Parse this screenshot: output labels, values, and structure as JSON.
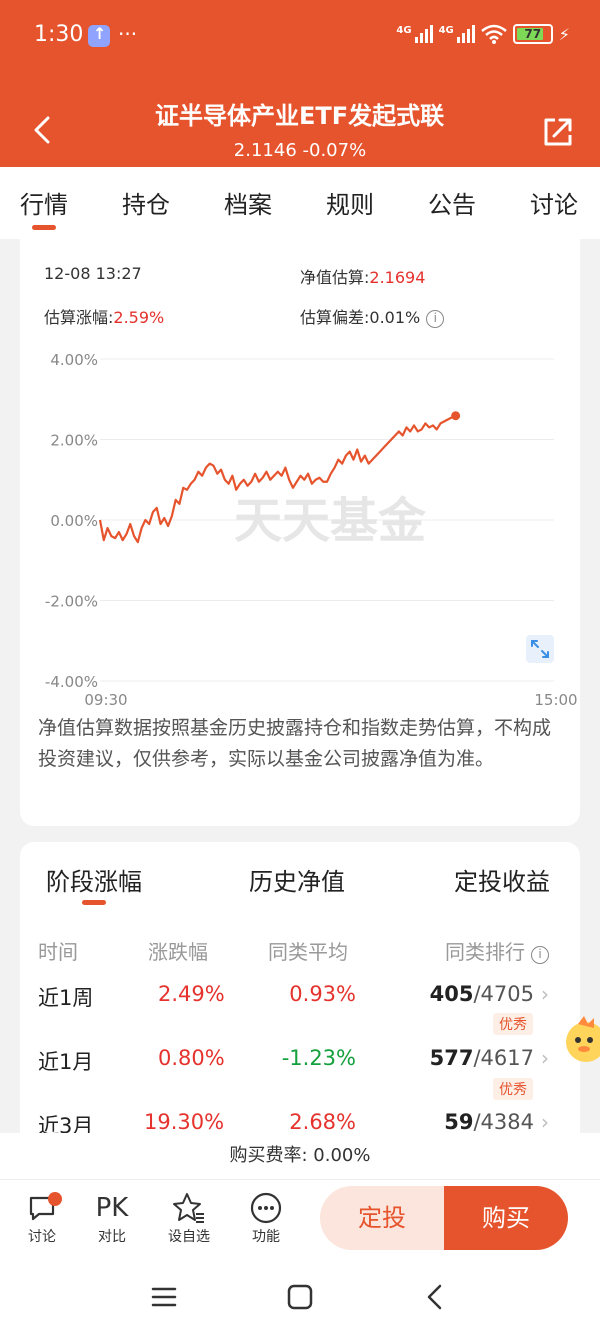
{
  "status_bar": {
    "time": "1:30",
    "battery": "77",
    "network_1": "4G",
    "network_2": "4G",
    "more": "···"
  },
  "header": {
    "title": "证半导体产业ETF发起式联",
    "subtitle": "2.1146 -0.07%"
  },
  "tabs": [
    "行情",
    "持仓",
    "档案",
    "规则",
    "公告",
    "讨论"
  ],
  "estimate": {
    "datetime": "12-08 13:27",
    "nav_label": "净值估算:",
    "nav_value": "2.1694",
    "change_label": "估算涨幅:",
    "change_value": "2.59%",
    "deviation_label": "估算偏差:",
    "deviation_value": "0.01%"
  },
  "chart_data": {
    "type": "line",
    "title": "",
    "xlabel": "",
    "ylabel": "",
    "y_tick_labels": [
      "4.00%",
      "2.00%",
      "0.00%",
      "-2.00%",
      "-4.00%"
    ],
    "x_tick_labels": [
      "09:30",
      "15:00"
    ],
    "ylim": [
      -4,
      4
    ],
    "xlim_minutes": [
      0,
      240
    ],
    "grid": true,
    "watermark": "天天基金",
    "series": [
      {
        "color": "#e6542d",
        "x": [
          0,
          2,
          4,
          6,
          8,
          10,
          12,
          14,
          16,
          18,
          20,
          22,
          24,
          26,
          28,
          30,
          32,
          34,
          36,
          38,
          40,
          42,
          44,
          46,
          48,
          50,
          52,
          54,
          56,
          58,
          60,
          62,
          64,
          66,
          68,
          70,
          72,
          74,
          76,
          78,
          80,
          82,
          84,
          86,
          88,
          90,
          92,
          94,
          96,
          98,
          100,
          102,
          104,
          106,
          108,
          110,
          112,
          114,
          116,
          118,
          120,
          122,
          124,
          126,
          128,
          130,
          132,
          134,
          136,
          138,
          140,
          142,
          144,
          146,
          148,
          150,
          152,
          154,
          156,
          158,
          160,
          162,
          164,
          166,
          168,
          170,
          172,
          174,
          176,
          178,
          180,
          182,
          184,
          186,
          188,
          190,
          192,
          194,
          196,
          198,
          200,
          202,
          204,
          206
        ],
        "y": [
          0.0,
          -0.5,
          -0.2,
          -0.4,
          -0.45,
          -0.3,
          -0.5,
          -0.35,
          -0.1,
          -0.4,
          -0.55,
          -0.2,
          0.0,
          -0.1,
          0.2,
          0.3,
          -0.1,
          0.05,
          -0.15,
          0.1,
          0.5,
          0.4,
          0.8,
          0.75,
          0.9,
          1.0,
          1.2,
          1.1,
          1.3,
          1.4,
          1.35,
          1.15,
          1.25,
          1.0,
          0.9,
          1.1,
          0.75,
          0.9,
          1.0,
          0.85,
          0.95,
          1.15,
          0.95,
          1.05,
          1.2,
          1.0,
          1.1,
          1.2,
          1.1,
          1.3,
          1.0,
          0.8,
          0.95,
          1.1,
          1.0,
          1.15,
          0.9,
          1.0,
          1.05,
          0.95,
          0.95,
          1.15,
          1.3,
          1.5,
          1.4,
          1.6,
          1.7,
          1.5,
          1.75,
          1.45,
          1.6,
          1.4,
          1.5,
          1.6,
          1.7,
          1.8,
          1.9,
          2.0,
          2.1,
          2.2,
          2.1,
          2.3,
          2.2,
          2.35,
          2.2,
          2.25,
          2.4,
          2.3,
          2.35,
          2.25,
          2.4,
          2.45,
          2.5,
          2.55,
          2.59,
          null,
          null,
          null,
          null,
          null,
          null,
          null,
          null,
          null
        ]
      }
    ]
  },
  "note": "净值估算数据按照基金历史披露持仓和指数走势估算，不构成投资建议，仅供参考，实际以基金公司披露净值为准。",
  "performance": {
    "subtabs": [
      "阶段涨幅",
      "历史净值",
      "定投收益"
    ],
    "headers": [
      "时间",
      "涨跌幅",
      "同类平均",
      "同类排行"
    ],
    "rows": [
      {
        "period": "近1周",
        "change": "2.49%",
        "avg": "0.93%",
        "rank": "405",
        "total": "/4705",
        "badge": "优秀"
      },
      {
        "period": "近1月",
        "change": "0.80%",
        "avg": "-1.23%",
        "rank": "577",
        "total": "/4617",
        "badge": "优秀"
      },
      {
        "period": "近3月",
        "change": "19.30%",
        "avg": "2.68%",
        "rank": "59",
        "total": "/4384",
        "badge": ""
      }
    ]
  },
  "fee": "购买费率: 0.00%",
  "bottom_bar": {
    "items": [
      "讨论",
      "对比",
      "设自选",
      "功能"
    ],
    "pk_label": "PK",
    "dingtou_label": "定投",
    "buy_label": "购买"
  },
  "colors": {
    "brand": "#e6542d",
    "up": "#e5322d",
    "down": "#14a03c"
  }
}
